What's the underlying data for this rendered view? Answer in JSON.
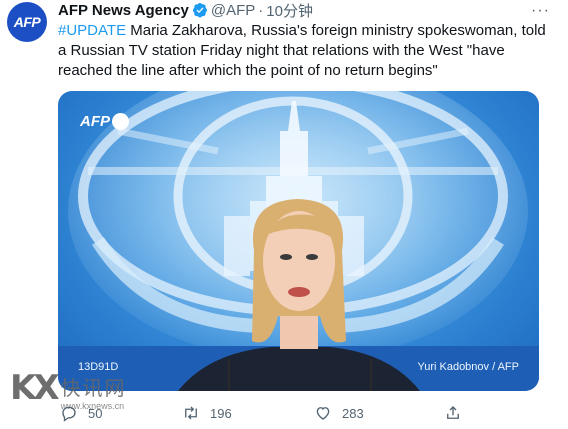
{
  "tweet": {
    "avatar_text": "AFP",
    "author_name": "AFP News Agency",
    "handle": "@AFP",
    "separator": "·",
    "time": "10分钟",
    "hashtag": "#UPDATE",
    "text": " Maria Zakharova, Russia's foreign ministry spokeswoman, told a Russian TV station Friday night that relations with the West \"have reached the line after which the point of no return begins\""
  },
  "media": {
    "overlay_logo": "AFP",
    "code": "13D91D",
    "credit": "Yuri Kadobnov / AFP"
  },
  "watermark": {
    "logo": "KX",
    "cn_text": "快讯网",
    "url": "www.kxnews.cn"
  },
  "actions": {
    "replies": "50",
    "retweets": "196",
    "likes": "283"
  },
  "colors": {
    "accent": "#1d9bf0",
    "avatar_bg": "#1d4fc4",
    "muted": "#536471"
  }
}
